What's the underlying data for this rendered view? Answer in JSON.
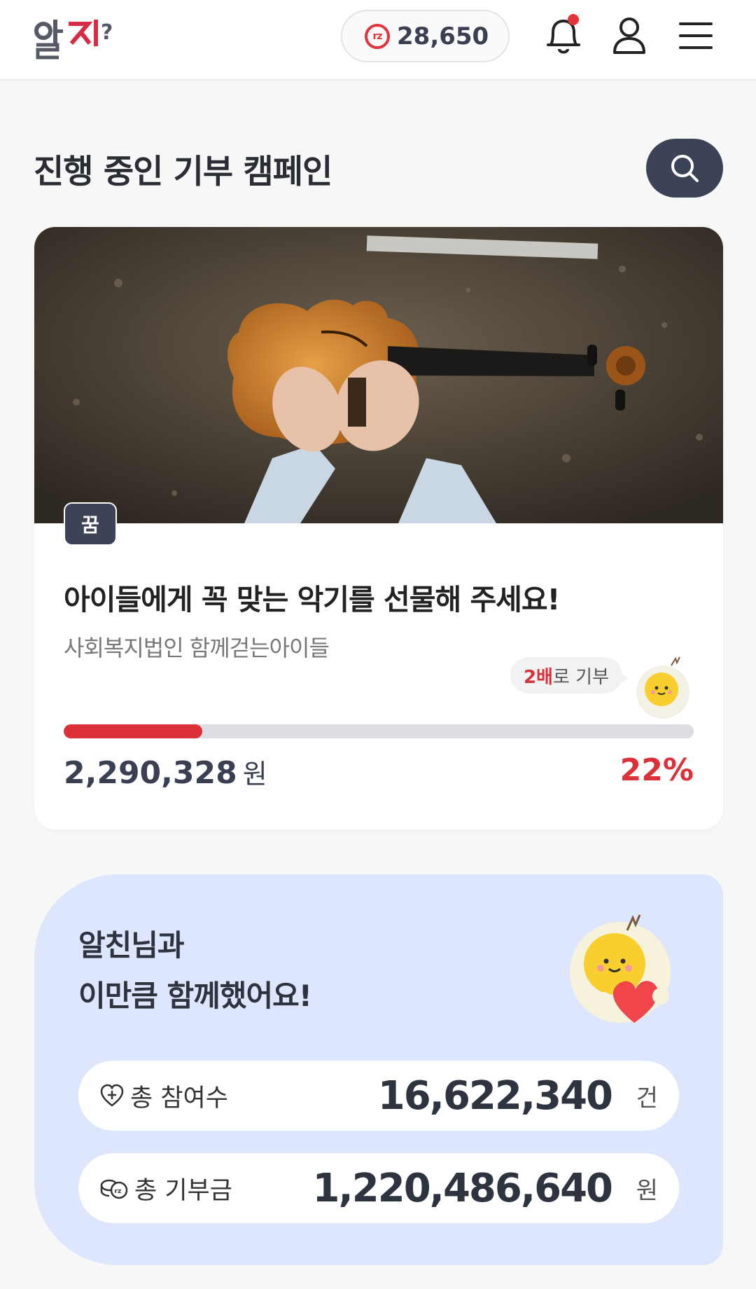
{
  "header": {
    "logo_text": "알지?",
    "points_icon": "rz",
    "points_value": "28,650",
    "icons": [
      "bell-icon",
      "user-icon",
      "menu-icon"
    ],
    "has_notification": true
  },
  "section": {
    "title": "진행 중인 기부 캠페인",
    "search_icon": "search-icon"
  },
  "campaign": {
    "tag": "꿈",
    "title": "아이들에게 꼭 맞는 악기를 선물해 주세요!",
    "organization": "사회복지법인 함께걷는아이들",
    "badge_highlight": "2배",
    "badge_text": "로 기부",
    "progress": 22,
    "amount": "2,290,328",
    "amount_unit": "원",
    "percent_label": "22%"
  },
  "stats": {
    "headline_1": "알친님과",
    "headline_2": "이만큼 함께했어요!",
    "participants_label": "총 참여수",
    "participants_value": "16,622,340",
    "participants_unit": "건",
    "donation_label": "총 기부금",
    "donation_value": "1,220,486,640",
    "donation_unit": "원"
  },
  "colors": {
    "accent_red": "#dc3138",
    "navy": "#3d4356",
    "stats_bg": "#dde6fd"
  }
}
